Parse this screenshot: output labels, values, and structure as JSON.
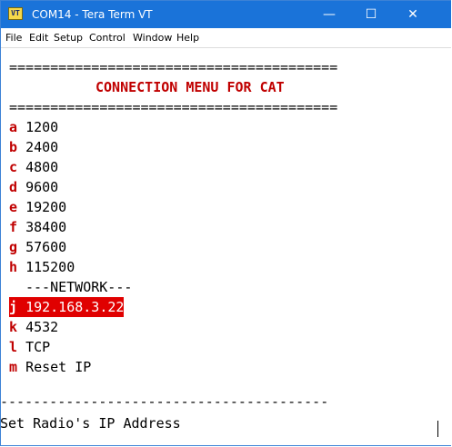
{
  "window": {
    "icon_label": "VT",
    "title": "COM14 - Tera Term VT",
    "controls": {
      "minimize": "—",
      "maximize": "☐",
      "close": "✕"
    }
  },
  "menubar": [
    "File",
    "Edit",
    "Setup",
    "Control",
    "Window",
    "Help"
  ],
  "terminal": {
    "rule_top": "========================================",
    "title": "CONNECTION MENU FOR CAT",
    "rule_mid": "========================================",
    "options": [
      {
        "key": "a",
        "value": "1200"
      },
      {
        "key": "b",
        "value": "2400"
      },
      {
        "key": "c",
        "value": "4800"
      },
      {
        "key": "d",
        "value": "9600"
      },
      {
        "key": "e",
        "value": "19200"
      },
      {
        "key": "f",
        "value": "38400"
      },
      {
        "key": "g",
        "value": "57600"
      },
      {
        "key": "h",
        "value": "115200"
      }
    ],
    "network_label": "---NETWORK---",
    "network_options": [
      {
        "key": "j",
        "value": "192.168.3.22",
        "selected": true
      },
      {
        "key": "k",
        "value": "4532"
      },
      {
        "key": "l",
        "value": "TCP"
      },
      {
        "key": "m",
        "value": "Reset IP"
      }
    ],
    "rule_bottom": "----------------------------------------",
    "prompt": "Set Radio's IP Address"
  },
  "colors": {
    "titlebar": "#1a73d9",
    "key": "#c00000",
    "highlight": "#e00000"
  }
}
